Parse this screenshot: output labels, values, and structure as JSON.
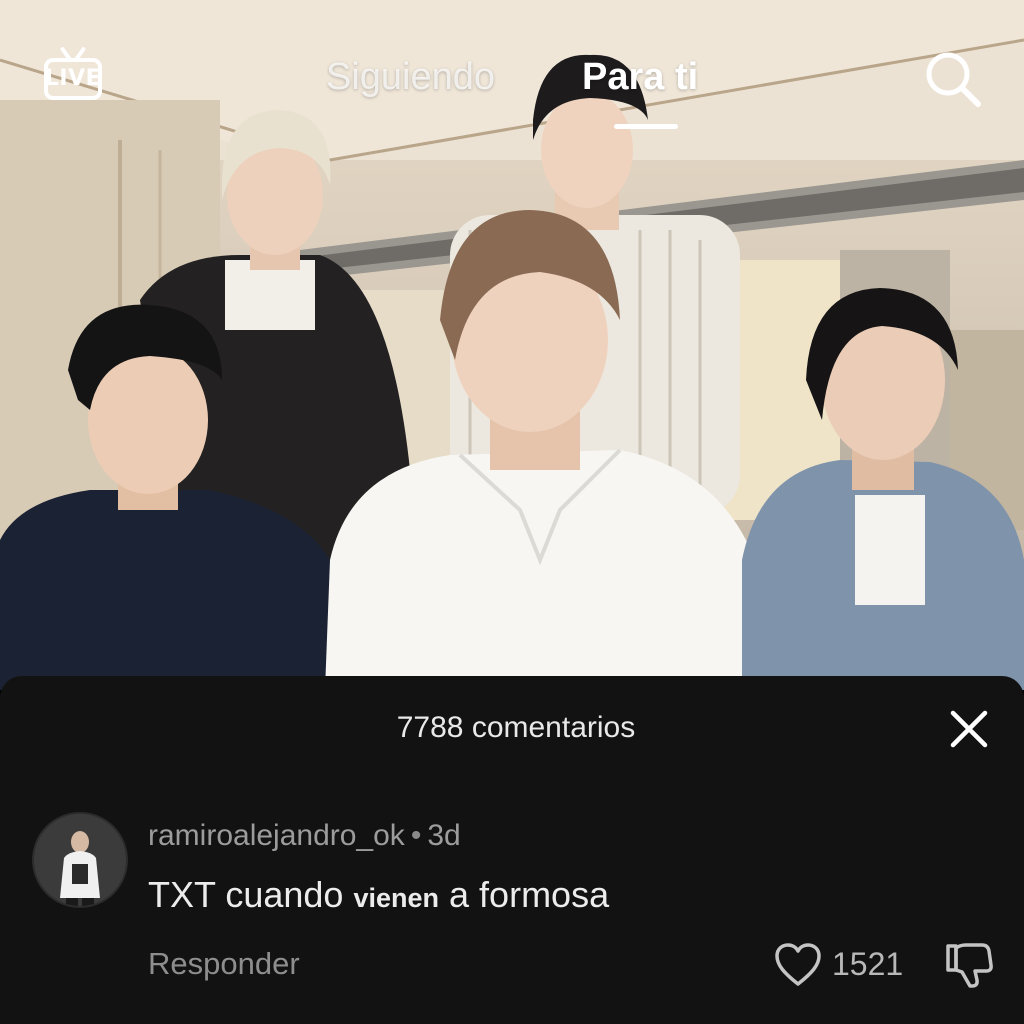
{
  "app": {
    "topnav": {
      "live_label": "LIVE",
      "tabs": [
        {
          "label": "Siguiendo",
          "active": false
        },
        {
          "label": "Para ti",
          "active": true
        }
      ],
      "live_icon": "tv-live-icon",
      "search_icon": "search-icon"
    },
    "comments": {
      "header": "7788 comentarios",
      "close_icon": "close-icon",
      "items": [
        {
          "username": "ramiroalejandro_ok",
          "separator": "•",
          "age": "3d",
          "text_before": "TXT cuando",
          "text_bold": "vienen",
          "text_after": "a formosa",
          "reply_label": "Responder",
          "like_count": "1521",
          "like_icon": "heart-icon",
          "dislike_icon": "thumbs-down-icon"
        }
      ]
    },
    "colors": {
      "sheet_bg": "#121212",
      "text_primary": "#ececec",
      "text_secondary": "#9c9c9c"
    }
  }
}
